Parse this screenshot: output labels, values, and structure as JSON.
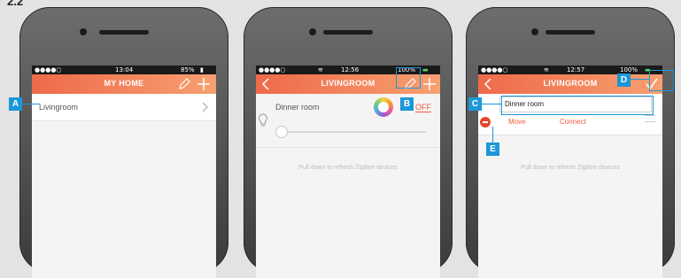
{
  "page_heading": "2.2",
  "phones": [
    {
      "status_time": "13:04",
      "status_battery": "85%",
      "header_title": "MY HOME",
      "list_items": [
        {
          "label": "Livingroom"
        }
      ]
    },
    {
      "status_time": "12:56",
      "status_battery": "100%",
      "header_title": "LIVINGROOM",
      "device": {
        "name": "Dinner room",
        "power_state": "OFF",
        "brightness": 0
      },
      "hint": "Pull down to refresh ZigBee devices"
    },
    {
      "status_time": "12:57",
      "status_battery": "100%",
      "header_title": "LIVINGROOM",
      "edit": {
        "name_value": "Dinner room",
        "move_label": "Move",
        "connect_label": "Connect"
      },
      "hint": "Pull down to refresh ZigBee devices"
    }
  ],
  "callouts": {
    "a": "A",
    "b": "B",
    "c": "C",
    "d": "D",
    "e": "E"
  },
  "colors": {
    "accent": "#ee6a4b",
    "callout": "#1c97d8",
    "statusbar": "#1a1a1a"
  }
}
